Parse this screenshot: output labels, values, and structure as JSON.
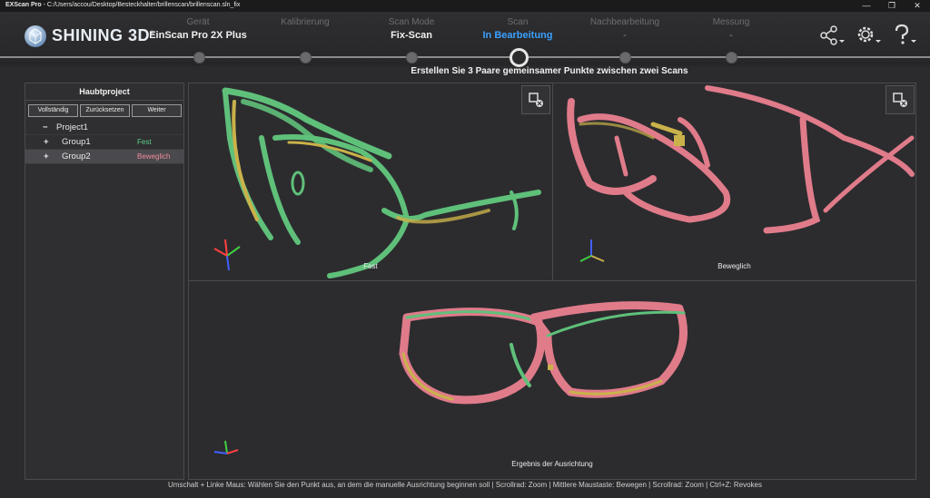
{
  "window": {
    "app_name": "EXScan Pro",
    "separator": " - ",
    "path": "C:/Users/accou/Desktop/Besteckhalter/brillenscan/brillenscan.sln_fix",
    "controls": [
      "—",
      "❐",
      "✕"
    ]
  },
  "header": {
    "brand": "SHINING 3D",
    "brand_mark": "®",
    "steps": [
      {
        "label": "Gerät",
        "value": "EinScan Pro 2X Plus",
        "state": "normal"
      },
      {
        "label": "Kalibrierung",
        "value": "",
        "state": "normal"
      },
      {
        "label": "Scan Mode",
        "value": "Fix-Scan",
        "state": "normal"
      },
      {
        "label": "Scan",
        "value": "In Bearbeitung",
        "state": "active"
      },
      {
        "label": "Nachbearbeitung",
        "value": "-",
        "state": "dim"
      },
      {
        "label": "Messung",
        "value": "-",
        "state": "dim"
      }
    ],
    "icons": [
      "share-icon",
      "gear-icon",
      "help-icon"
    ]
  },
  "instruction": "Erstellen Sie 3 Paare gemeinsamer Punkte zwischen zwei Scans",
  "project_panel": {
    "title": "Haubtproject",
    "buttons": [
      "Vollständig",
      "Zurücksetzen",
      "Weiter"
    ],
    "tree": [
      {
        "toggle": "−",
        "name": "Project1",
        "status": "",
        "status_color": ""
      },
      {
        "toggle": "+",
        "name": "Group1",
        "status": "Fest",
        "status_color": "#5fd08a"
      },
      {
        "toggle": "+",
        "name": "Group2",
        "status": "Beweglich",
        "status_color": "#f08a9a"
      }
    ]
  },
  "views": {
    "fixed_label": "Fest",
    "moving_label": "Beweglich",
    "result_label": "Ergebnis der Ausrichtung"
  },
  "colors": {
    "accent": "#3aa0ff",
    "fixed_scan": "#5fc07a",
    "moving_scan": "#e07b8a",
    "overlap": "#c9b24a"
  },
  "status_bar": "Umschalt + Linke Maus: Wählen Sie den Punkt aus, an dem die manuelle Ausrichtung beginnen soll | Scrollrad: Zoom | Mittlere Maustaste: Bewegen | Scrollrad: Zoom | Ctrl+Z: Revokes"
}
